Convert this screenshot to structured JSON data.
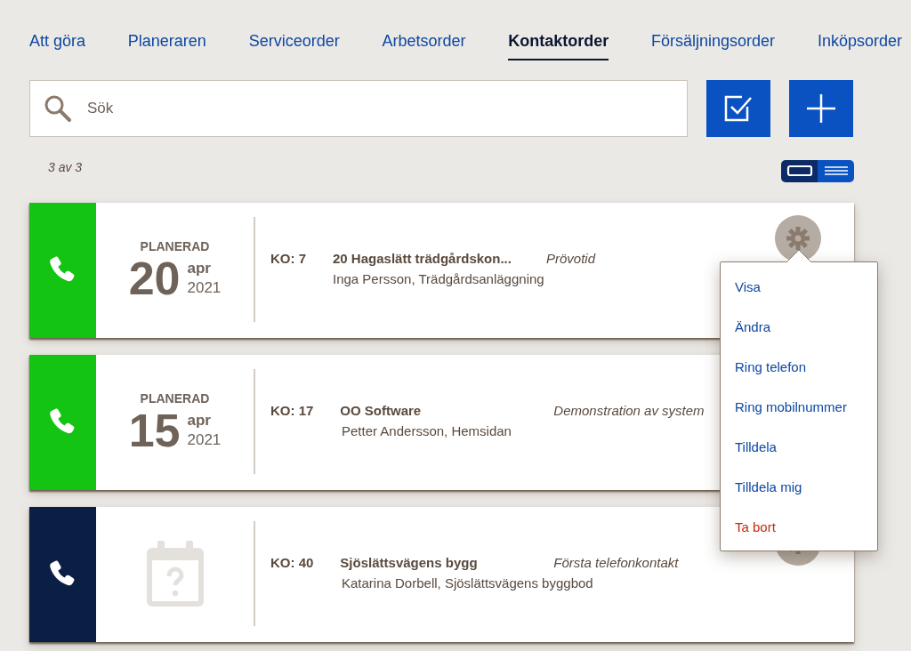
{
  "tabs": [
    {
      "label": "Att göra",
      "selected": false
    },
    {
      "label": "Planeraren",
      "selected": false
    },
    {
      "label": "Serviceorder",
      "selected": false
    },
    {
      "label": "Arbetsorder",
      "selected": false
    },
    {
      "label": "Kontaktorder",
      "selected": true
    },
    {
      "label": "Försäljningsorder",
      "selected": false
    },
    {
      "label": "Inköpsorder",
      "selected": false
    }
  ],
  "search": {
    "placeholder": "Sök"
  },
  "count": "3 av 3",
  "view_toggle": [
    {
      "kind": "cards",
      "selected": true
    },
    {
      "kind": "list",
      "selected": false
    }
  ],
  "cards": [
    {
      "color": "#13c413",
      "kind": "planned",
      "status": "PLANERAD",
      "day": "20",
      "month": "apr",
      "year": "2021",
      "number": "KO: 7",
      "title": "20 Hagaslätt trädgårdskon...",
      "type": "Prövotid",
      "contact": "Inga Persson, Trädgårdsanläggning",
      "settings_button": true
    },
    {
      "color": "#13c413",
      "kind": "planned",
      "status": "PLANERAD",
      "day": "15",
      "month": "apr",
      "year": "2021",
      "number": "KO: 17",
      "title": "OO Software",
      "type": "Demonstration av system",
      "contact": "Petter Andersson, Hemsidan",
      "settings_button": false
    },
    {
      "color": "#0b1f44",
      "kind": "unscheduled",
      "number": "KO: 40",
      "title": "Sjöslättsvägens bygg",
      "type": "Första telefonkontakt",
      "contact": "Katarina Dorbell, Sjöslättsvägens byggbod",
      "settings_button": true
    }
  ],
  "menu": [
    {
      "label": "Visa",
      "kind": "normal"
    },
    {
      "label": "Ändra",
      "kind": "normal"
    },
    {
      "label": "Ring telefon",
      "kind": "normal"
    },
    {
      "label": "Ring mobilnummer",
      "kind": "normal"
    },
    {
      "label": "Tilldela",
      "kind": "normal"
    },
    {
      "label": "Tilldela mig",
      "kind": "normal"
    },
    {
      "label": "Ta bort",
      "kind": "danger"
    }
  ]
}
